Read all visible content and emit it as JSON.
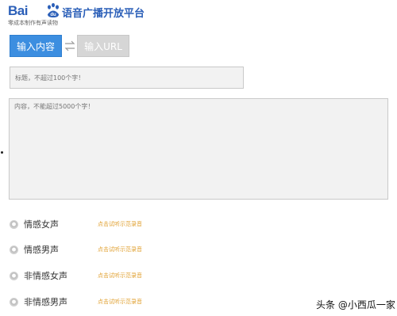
{
  "header": {
    "logo_text": "Bai",
    "logo_du": "du",
    "title": "语音广播开放平台",
    "slogan": "零成本制作有声读物"
  },
  "tabs": [
    {
      "label": "输入内容",
      "active": true
    },
    {
      "label": "输入URL",
      "active": false
    }
  ],
  "inputs": {
    "title_placeholder": "标题，不超过100个字！",
    "content_placeholder": "内容，不能超过5000个字！"
  },
  "voices": [
    {
      "name": "情感女声",
      "sample": "点击试听示范录音"
    },
    {
      "name": "情感男声",
      "sample": "点击试听示范录音"
    },
    {
      "name": "非情感女声",
      "sample": "点击试听示范录音"
    },
    {
      "name": "非情感男声",
      "sample": "点击试听示范录音"
    }
  ],
  "watermark": {
    "text": "头条 @小西瓜一家"
  },
  "colors": {
    "brand_blue": "#2b5fb8",
    "tab_active": "#3c8ee0",
    "tab_inactive": "#d6d6d6",
    "sample_link": "#e0a030"
  }
}
